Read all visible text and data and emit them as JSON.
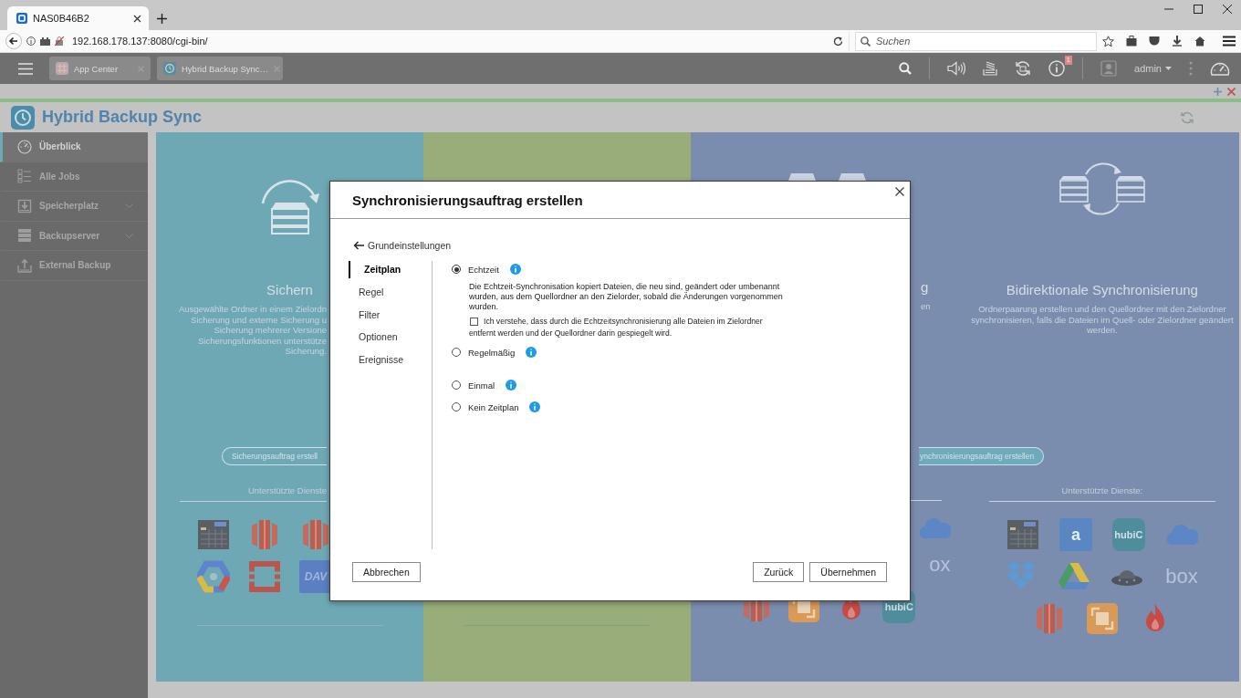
{
  "browser": {
    "tabs": [
      {
        "title": "NAS0B46B2",
        "selected": true
      }
    ],
    "address": "192.168.178.137:8080/cgi-bin/",
    "search": {
      "placeholder": "Suchen"
    }
  },
  "taskbar": {
    "tabs": [
      {
        "label": "App Center"
      },
      {
        "label": "Hybrid Backup Sync…"
      }
    ],
    "notification_count": "1",
    "user": "admin"
  },
  "app": {
    "title": "Hybrid Backup Sync",
    "sidebar": {
      "items": [
        {
          "label": "Überblick",
          "selected": true,
          "expandable": false
        },
        {
          "label": "Alle Jobs",
          "selected": false,
          "expandable": false
        },
        {
          "label": "Speicherplatz",
          "selected": false,
          "expandable": true
        },
        {
          "label": "Backupserver",
          "selected": false,
          "expandable": true
        },
        {
          "label": "External Backup",
          "selected": false,
          "expandable": false
        }
      ]
    },
    "panels": [
      {
        "color": "#6ea8b4",
        "columns": [
          {
            "kind": "backup",
            "title": "Sichern",
            "description": [
              "Ausgewählte Ordner in einem Zielordn",
              "Sicherung und externe Sicherung u",
              "Sicherung mehrerer Versione",
              "Sicherungsfunktionen unterstütze",
              "Sicherung."
            ],
            "button": "Sicherungsauftrag erstell",
            "services_label": "Unterstützte Dienste",
            "services": [
              [
                {
                  "kind": "nas"
                },
                {
                  "kind": "bucket"
                },
                {
                  "kind": "bucket"
                }
              ],
              [
                {
                  "kind": "hexagon"
                },
                {
                  "kind": "ring"
                },
                {
                  "kind": "dav",
                  "label": "DAV"
                }
              ]
            ]
          }
        ]
      },
      {
        "color": "#99ad7b",
        "columns": [
          {
            "kind": "plain"
          }
        ]
      },
      {
        "color": "#7b8daf",
        "columns": [
          {
            "kind": "one_way",
            "title": "g",
            "description": [
              "en"
            ],
            "button": "ynchronisierungsauftrag erstellen",
            "services": [
              [
                {
                  "kind": "cloud"
                }
              ],
              [
                {
                  "kind": "box",
                  "label": "ox"
                }
              ],
              [
                {
                  "kind": "bucket"
                },
                {
                  "kind": "copy"
                },
                {
                  "kind": "flame"
                },
                {
                  "kind": "hubic",
                  "label": "hubiC"
                }
              ]
            ]
          },
          {
            "kind": "two_way",
            "title": "Bidirektionale Synchronisierung",
            "description": [
              "Ordnerpaarung erstellen und den Quellordner mit den Zielordner synchronisieren, falls die Dateien im Quell- oder Zielordner geändert werden."
            ],
            "services_label": "Unterstützte Dienste:",
            "services": [
              [
                {
                  "kind": "nas"
                },
                {
                  "kind": "amazon",
                  "label": "a"
                },
                {
                  "kind": "hubic",
                  "label": "hubiC"
                },
                {
                  "kind": "cloud"
                }
              ],
              [
                {
                  "kind": "diamonds"
                },
                {
                  "kind": "triangle"
                },
                {
                  "kind": "ufo"
                },
                {
                  "kind": "box",
                  "label": "box"
                }
              ],
              [
                {
                  "kind": "bucket"
                },
                {
                  "kind": "copy"
                },
                {
                  "kind": "flame"
                }
              ]
            ]
          }
        ]
      }
    ]
  },
  "dialog": {
    "title": "Synchronisierungsauftrag erstellen",
    "back_link": "Grundeinstellungen",
    "steps": [
      {
        "label": "Zeitplan",
        "selected": true
      },
      {
        "label": "Regel",
        "selected": false
      },
      {
        "label": "Filter",
        "selected": false
      },
      {
        "label": "Optionen",
        "selected": false
      },
      {
        "label": "Ereignisse",
        "selected": false
      }
    ],
    "schedule_options": [
      {
        "label": "Echtzeit",
        "selected": true,
        "description": "Die Echtzeit-Synchronisation kopiert Dateien, die neu sind, geändert oder umbenannt wurden, aus dem Quellordner an den Zielorder, sobald die Änderungen vorgenommen wurden.",
        "confirmation": {
          "label": "Ich verstehe, dass durch die Echtzeitsynchronisierung alle Dateien im Zielordner entfernt werden und der Quellordner darin gespiegelt wird.",
          "checked": false
        }
      },
      {
        "label": "Regelmäßig",
        "selected": false
      },
      {
        "label": "Einmal",
        "selected": false
      },
      {
        "label": "Kein Zeitplan",
        "selected": false
      }
    ],
    "cancel_button": "Abbrechen",
    "buttons": [
      "Zurück",
      "Übernehmen"
    ]
  }
}
